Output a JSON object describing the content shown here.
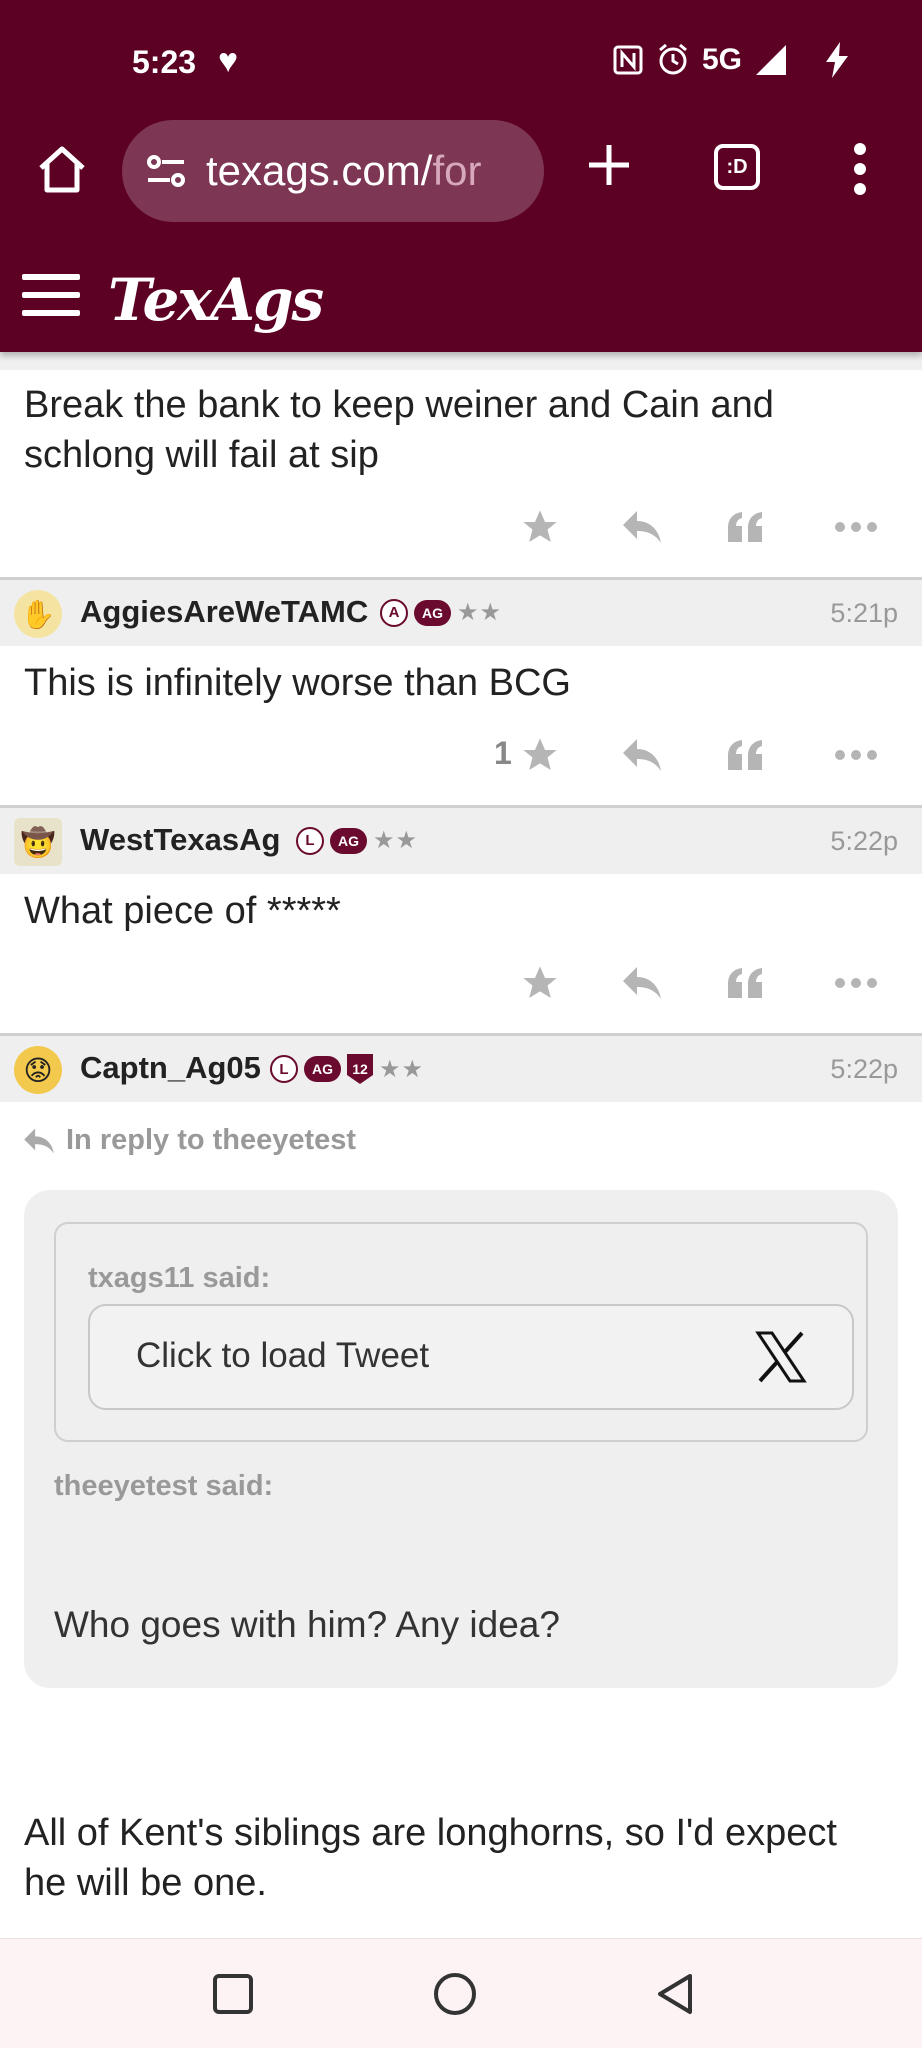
{
  "status_bar": {
    "time": "5:23",
    "network": "5G"
  },
  "browser": {
    "url_main": "texags.com/",
    "url_dim": "for",
    "tabs_label": ":D"
  },
  "app": {
    "logo": "TexAgs",
    "brand_color": "#5c0024"
  },
  "posts": [
    {
      "text_line1": "Break the bank to keep weiner and Cain and",
      "text_line2": "schlong will fail at sip",
      "likes": ""
    },
    {
      "username": "AggiesAreWeTAMC",
      "badge_letter": "A",
      "badge_ag": "AG",
      "stars": "★★",
      "time": "5:21p",
      "text": "This is infinitely worse than BCG",
      "likes": "1"
    },
    {
      "username": "WestTexasAg",
      "badge_letter": "L",
      "badge_ag": "AG",
      "stars": "★★",
      "time": "5:22p",
      "text": "What piece of *****",
      "likes": ""
    },
    {
      "username": "Captn_Ag05",
      "badge_letter": "L",
      "badge_ag": "AG",
      "badge_shield": "12",
      "stars": "★★",
      "time": "5:22p",
      "reply_to": "In reply to theeyetest",
      "nested_quote_author": "txags11 said:",
      "tweet_placeholder": "Click to load Tweet",
      "quote_author": "theeyetest said:",
      "quote_text": "Who goes with him? Any idea?",
      "text_line1": "All of Kent's siblings are longhorns, so I'd expect",
      "text_line2": "he will be one."
    }
  ]
}
